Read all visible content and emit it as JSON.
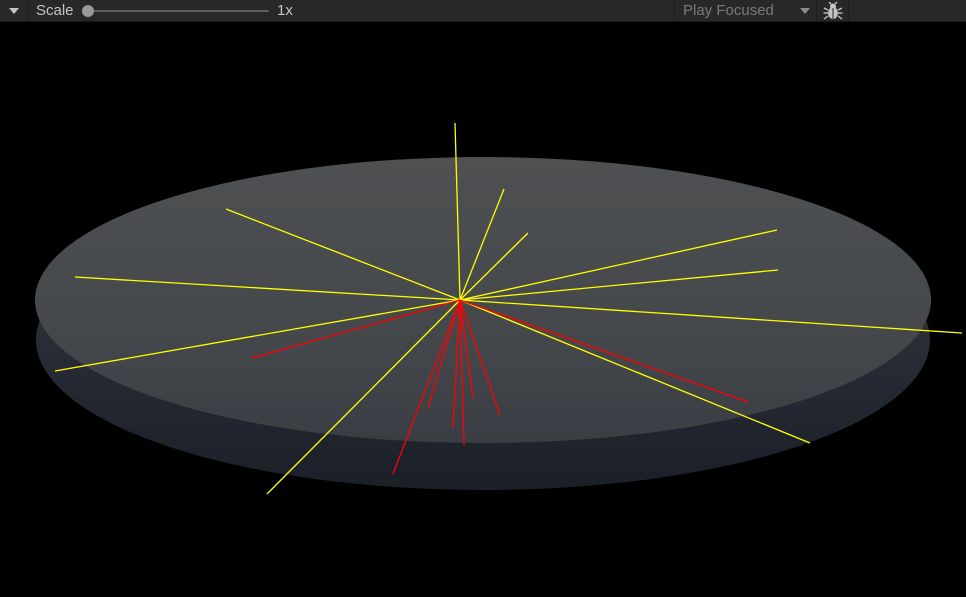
{
  "toolbar": {
    "menu_icon": "triangle-down-icon",
    "scale_label": "Scale",
    "scale_value_label": "1x",
    "scale_slider_value": 1,
    "play_mode_selected": "Play Focused",
    "bug_icon": "bug-icon"
  },
  "scene": {
    "background": "#000000",
    "disc_color": "#4a4d50",
    "ray_colors": {
      "hit": "#ffff00",
      "blocked": "#ff0000"
    }
  }
}
